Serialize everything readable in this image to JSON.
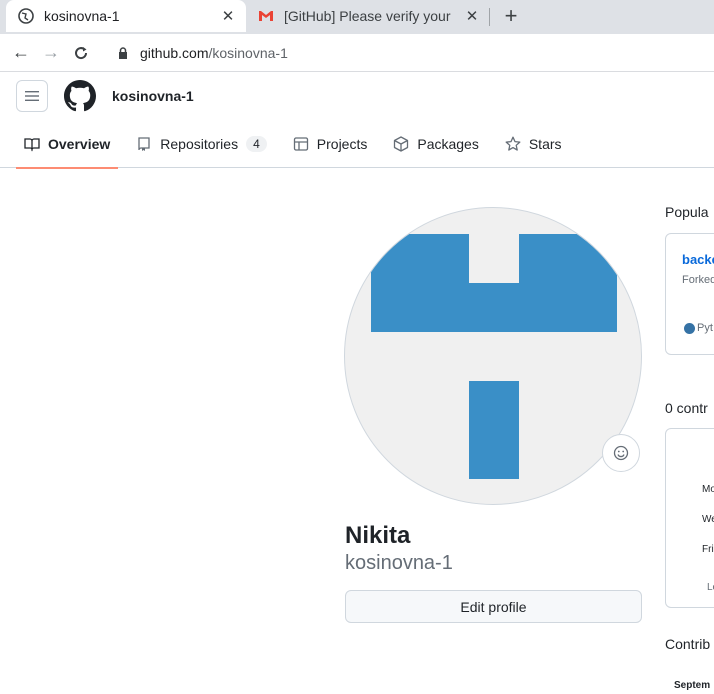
{
  "browser": {
    "tabs": [
      {
        "title": "kosinovna-1",
        "active": true
      },
      {
        "title": "[GitHub] Please verify your",
        "active": false
      }
    ],
    "new_tab_symbol": "+",
    "url_host": "github.com",
    "url_path": "/kosinovna-1"
  },
  "header": {
    "username": "kosinovna-1"
  },
  "profile_tabs": [
    {
      "label": "Overview",
      "icon": "book-icon"
    },
    {
      "label": "Repositories",
      "icon": "repo-icon",
      "count": "4"
    },
    {
      "label": "Projects",
      "icon": "table-icon"
    },
    {
      "label": "Packages",
      "icon": "package-icon"
    },
    {
      "label": "Stars",
      "icon": "star-icon"
    }
  ],
  "profile": {
    "name": "Nikita",
    "login": "kosinovna-1",
    "edit_label": "Edit profile",
    "avatar_color": "#3a8fc7"
  },
  "sidebar": {
    "popular_heading": "Popula",
    "repo_name": "backe",
    "repo_fork": "Forked",
    "repo_lang": "Pyt",
    "contrib_heading": "0 contr",
    "days": [
      "Mo",
      "We",
      "Fri"
    ],
    "learn": "Le",
    "activity_heading": "Contrib",
    "month": "Septem"
  }
}
